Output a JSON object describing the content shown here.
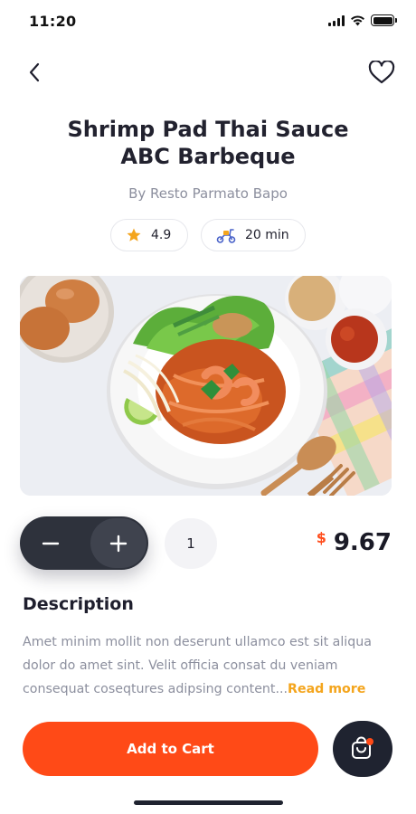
{
  "status_bar": {
    "time": "11:20",
    "battery_level": 1.0
  },
  "nav": {
    "back_icon": "chevron-left-icon",
    "favorite_icon": "heart-icon"
  },
  "product": {
    "title_line1": "Shrimp Pad Thai Sauce",
    "title_line2": "ABC Barbeque",
    "by_line": "By Resto Parmato Bapo",
    "rating": "4.9",
    "delivery_time": "20 min",
    "image_icon": "food-photo"
  },
  "quantity": {
    "minus_icon": "minus-icon",
    "plus_icon": "plus-icon",
    "value": "1"
  },
  "price": {
    "currency": "$",
    "value": "9.67"
  },
  "description": {
    "heading": "Description",
    "body": "Amet minim mollit non deserunt ullamco est sit aliqua dolor do amet sint. Velit officia consat du veniam consequat coseqtures adipsing content...",
    "read_more": "Read more"
  },
  "actions": {
    "add_to_cart": "Add to Cart",
    "cart_icon": "shopping-bag-icon"
  },
  "colors": {
    "accent": "#ff4a17",
    "star": "#f4a51d",
    "dark": "#2e323c",
    "muted_text": "#8c8f9e"
  }
}
